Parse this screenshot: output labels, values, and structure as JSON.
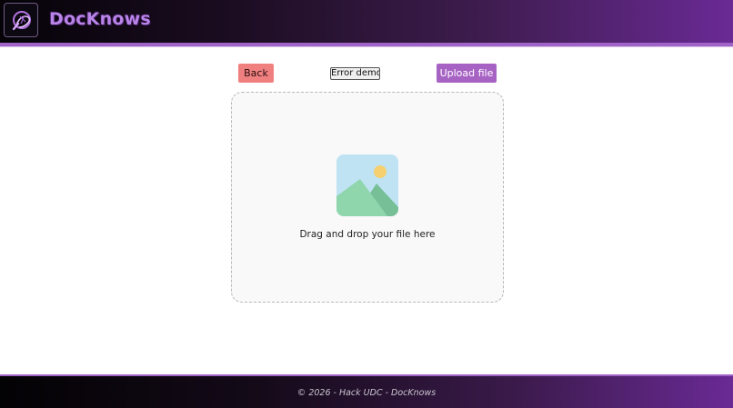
{
  "header": {
    "brand": "DocKnows",
    "logo_icon": "docknows-logo-icon"
  },
  "actions": {
    "back_label": "Back",
    "error_demo_label": "Error demo",
    "upload_label": "Upload file"
  },
  "dropzone": {
    "icon": "image-placeholder-icon",
    "text": "Drag and drop your file here"
  },
  "footer": {
    "text": "© 2026 - Hack UDC - DocKnows"
  },
  "colors": {
    "accent_purple": "#a763c3",
    "back_red": "#f08080",
    "brand_text": "#b884e8"
  }
}
